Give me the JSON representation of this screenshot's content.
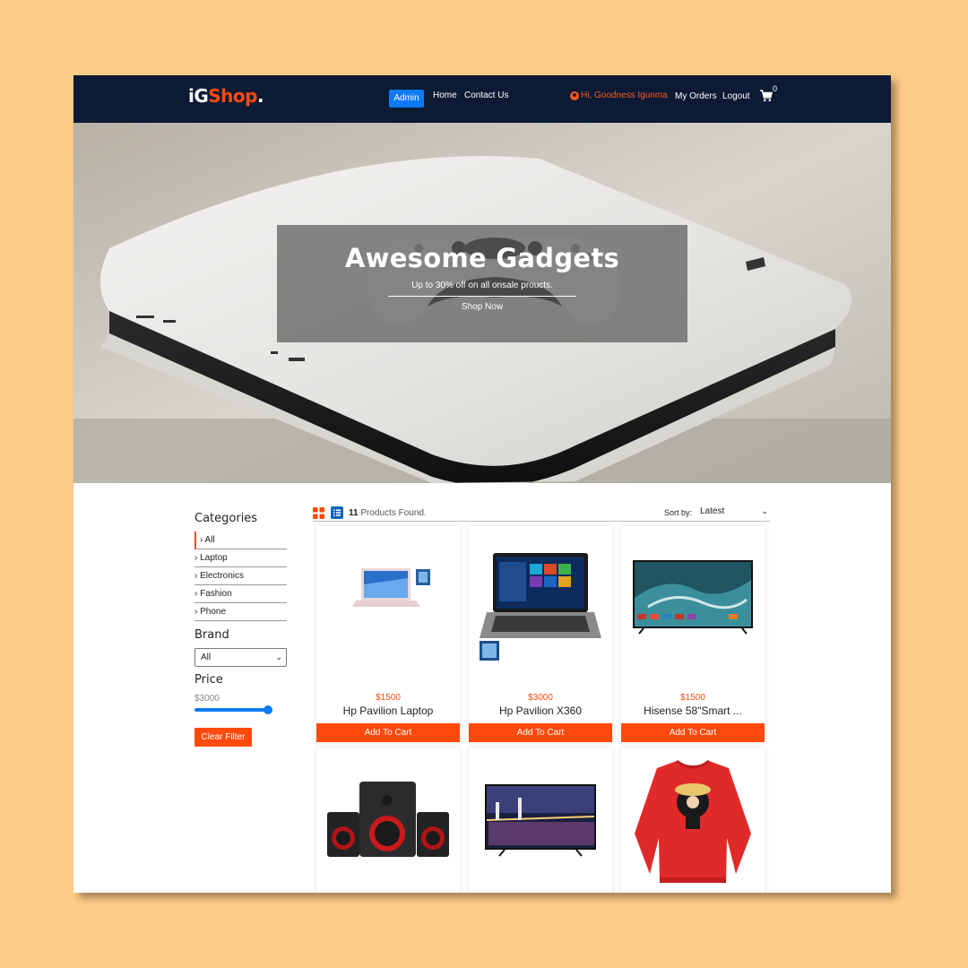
{
  "navbar": {
    "logo_i": "iG",
    "logo_shop": "Shop",
    "logo_dot": ".",
    "admin_label": "Admin",
    "home_label": "Home",
    "contact_label": "Contact Us",
    "greeting": "Hi, Goodness Igunma",
    "orders_label": "My Orders",
    "logout_label": "Logout",
    "cart_count": "0"
  },
  "hero": {
    "title": "Awesome Gadgets",
    "subtitle": "Up to 30% off on all onsale proucts.",
    "cta_label": "Shop Now"
  },
  "sidebar": {
    "categories_title": "Categories",
    "categories": [
      "› All",
      "› Laptop",
      "› Electronics",
      "› Fashion",
      "› Phone"
    ],
    "brand_title": "Brand",
    "brand_selected": "All",
    "price_title": "Price",
    "price_value": "$3000",
    "price_slider_fraction": 1.0,
    "clear_label": "Clear Filter"
  },
  "toolbar": {
    "count": "11",
    "found_text": "Products Found.",
    "sort_label": "Sort by:",
    "sort_selected": "Latest"
  },
  "products": [
    {
      "price": "$1500",
      "name": "Hp Pavilion Laptop",
      "button": "Add To Cart"
    },
    {
      "price": "$3000",
      "name": "Hp Pavilion X360",
      "button": "Add To Cart"
    },
    {
      "price": "$1500",
      "name": "Hisense 58\"Smart ...",
      "button": "Add To Cart"
    },
    {
      "price": "",
      "name": "",
      "button": ""
    },
    {
      "price": "",
      "name": "",
      "button": ""
    },
    {
      "price": "",
      "name": "",
      "button": ""
    }
  ],
  "colors": {
    "navbar_bg": "#0c1a35",
    "accent": "#ff4a0d",
    "primary_blue": "#0d7bf2",
    "page_bg": "#ffcc87"
  }
}
